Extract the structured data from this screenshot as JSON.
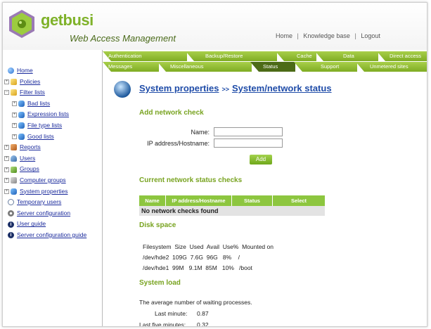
{
  "app": {
    "brand": "getbusi",
    "tagline": "Web Access Management"
  },
  "toplinks": [
    "Home",
    "Knowledge base",
    "Logout"
  ],
  "sidebar": {
    "items": [
      {
        "label": "Home",
        "icon": "blue-globe-icon",
        "expandable": false
      },
      {
        "label": "Policies",
        "icon": "yellow-folder-icon",
        "expandable": true
      },
      {
        "label": "Filter lists",
        "icon": "yellow-folder-icon",
        "expandable": true
      },
      {
        "label": "Bad lists",
        "icon": "blue-cube-icon",
        "expandable": true
      },
      {
        "label": "Expression lists",
        "icon": "blue-cube-icon",
        "expandable": true
      },
      {
        "label": "File type lists",
        "icon": "blue-cube-icon",
        "expandable": true
      },
      {
        "label": "Good lists",
        "icon": "blue-cube-icon",
        "expandable": true
      },
      {
        "label": "Reports",
        "icon": "report-icon",
        "expandable": true
      },
      {
        "label": "Users",
        "icon": "user-icon",
        "expandable": true
      },
      {
        "label": "Groups",
        "icon": "groups-icon",
        "expandable": true
      },
      {
        "label": "Computer groups",
        "icon": "computer-icon",
        "expandable": true
      },
      {
        "label": "System properties",
        "icon": "system-icon",
        "expandable": true
      },
      {
        "label": "Temporary users",
        "icon": "clock-icon",
        "expandable": false
      },
      {
        "label": "Server configuration",
        "icon": "gear-icon",
        "expandable": false
      },
      {
        "label": "User guide",
        "icon": "info-icon",
        "expandable": false
      },
      {
        "label": "Server configuration guide",
        "icon": "info-icon",
        "expandable": false
      }
    ]
  },
  "tabs": {
    "row1": [
      "Authentication",
      "Backup/Restore",
      "Cache",
      "Data",
      "Direct access"
    ],
    "row2": [
      "Messages",
      "Miscellaneous",
      "Status",
      "Support",
      "Unmetered sites"
    ],
    "active": "Status"
  },
  "page": {
    "crumb_parent": "System properties",
    "crumb_sep": ">>",
    "crumb_current": "System/network status"
  },
  "add_check": {
    "title": "Add network check",
    "name_label": "Name:",
    "name_value": "",
    "host_label": "IP address/Hostname:",
    "host_value": "",
    "add_button": "Add"
  },
  "current_checks": {
    "title": "Current network status checks",
    "columns": [
      "Name",
      "IP address/Hostname",
      "Status",
      "Select"
    ],
    "empty_message": "No network checks found"
  },
  "disk_space": {
    "title": "Disk space",
    "header": "Filesystem  Size  Used  Avail  Use%  Mounted on",
    "rows": [
      "/dev/hde2  109G  7.6G  96G   8%    /",
      "/dev/hde1  99M   9.1M  85M   10%   /boot"
    ]
  },
  "system_load": {
    "title": "System load",
    "description": "The average number of waiting processes.",
    "last_minute_label": "Last minute:",
    "last_minute_value": "0.87",
    "last_five_label": "Last five minutes:",
    "last_five_value": "0.32"
  }
}
